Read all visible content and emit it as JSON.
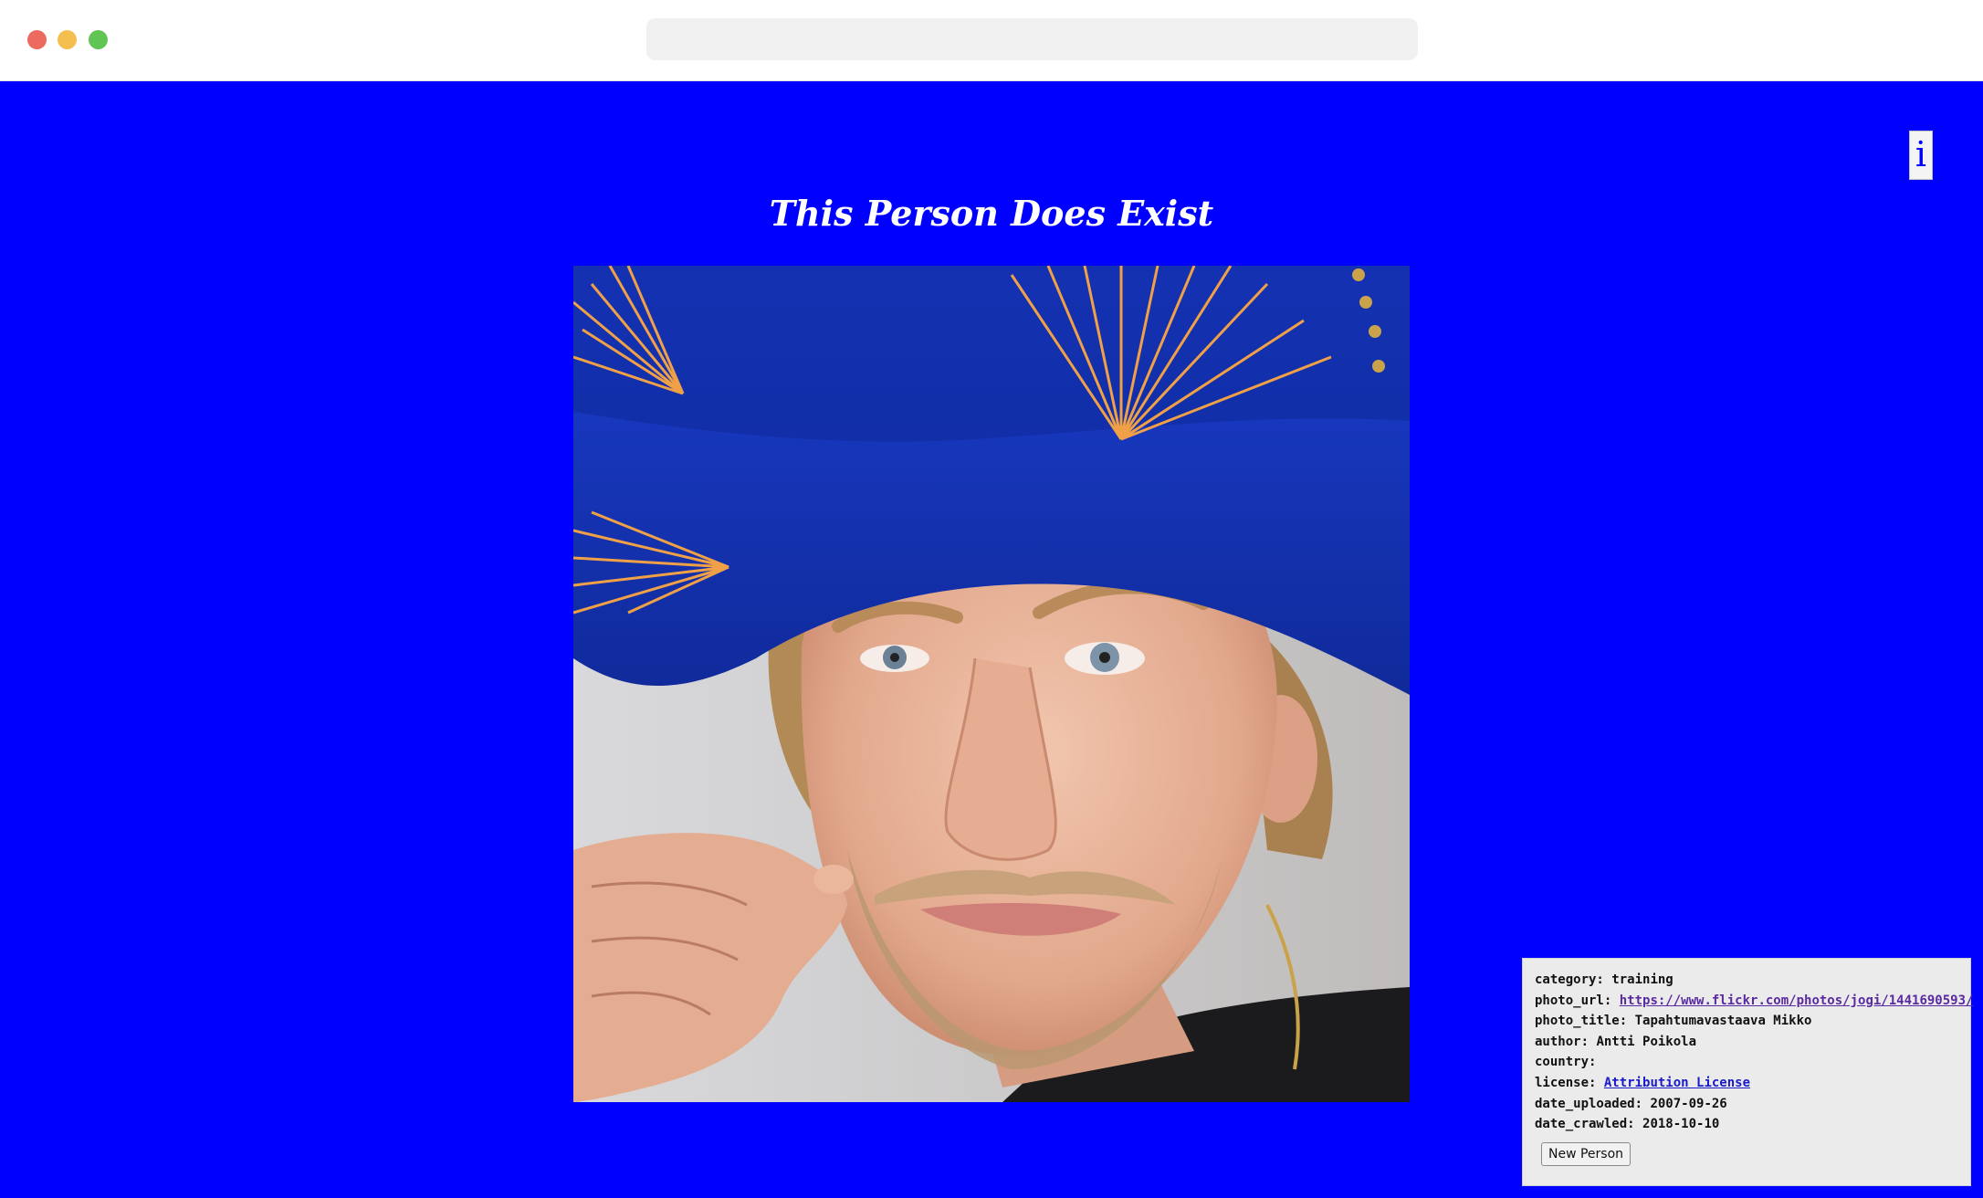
{
  "browser": {
    "url": ""
  },
  "page": {
    "title": "This Person Does Exist",
    "info_button": "i",
    "background_color": "#0000ff"
  },
  "photo": {
    "subject": "man wearing a blue sombrero with orange stitching, twirling his mustache"
  },
  "metadata": {
    "category_label": "category:",
    "category": "training",
    "photo_url_label": "photo_url:",
    "photo_url": "https://www.flickr.com/photos/jogi/1441690593/",
    "photo_title_label": "photo_title:",
    "photo_title": "Tapahtumavastaava Mikko",
    "author_label": "author:",
    "author": "Antti Poikola",
    "country_label": "country:",
    "country": "",
    "license_label": "license:",
    "license": "Attribution License",
    "date_uploaded_label": "date_uploaded:",
    "date_uploaded": "2007-09-26",
    "date_crawled_label": "date_crawled:",
    "date_crawled": "2018-10-10",
    "new_person_button": "New Person"
  }
}
